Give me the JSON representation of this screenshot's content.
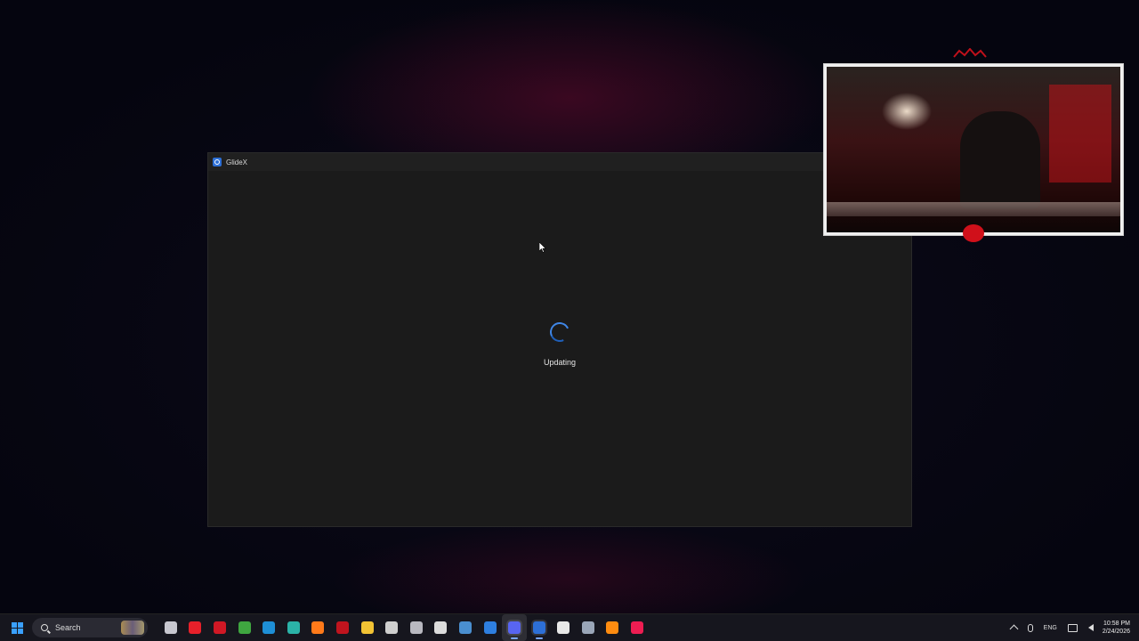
{
  "window": {
    "title": "GlideX",
    "icon": "glidex-app-icon",
    "status_text": "Updating",
    "spinner_color": "#3f86e6"
  },
  "overlay": {
    "name": "webcam-overlay"
  },
  "taskbar": {
    "search_label": "Search",
    "apps": [
      {
        "name": "task-view-icon",
        "color": "#c8c8d0",
        "active": false
      },
      {
        "name": "flash-app-icon",
        "color": "#e8202a",
        "active": false
      },
      {
        "name": "red-app-icon",
        "color": "#d01825",
        "active": false
      },
      {
        "name": "green-grid-app-icon",
        "color": "#3fa640",
        "active": false
      },
      {
        "name": "edge-browser-icon",
        "color": "#1e8fd6",
        "active": false
      },
      {
        "name": "teal-c-app-icon",
        "color": "#2bb3a8",
        "active": false
      },
      {
        "name": "firefox-icon",
        "color": "#ff7a1a",
        "active": false
      },
      {
        "name": "opera-icon",
        "color": "#c0141e",
        "active": false
      },
      {
        "name": "file-explorer-icon",
        "color": "#f2c334",
        "active": false
      },
      {
        "name": "unity-icon",
        "color": "#cfcfcf",
        "active": false
      },
      {
        "name": "github-desktop-icon",
        "color": "#b8b8c0",
        "active": false
      },
      {
        "name": "epic-games-icon",
        "color": "#dcdcdc",
        "active": false
      },
      {
        "name": "steam-icon",
        "color": "#4a8fd0",
        "active": false
      },
      {
        "name": "blue-app-icon",
        "color": "#2e7fe0",
        "active": false
      },
      {
        "name": "discord-icon",
        "color": "#5865f2",
        "active": true,
        "highlight": true
      },
      {
        "name": "glidex-taskbar-icon",
        "color": "#2d6fd6",
        "active": true,
        "highlight": false
      },
      {
        "name": "capcut-icon",
        "color": "#e8e8e8",
        "active": false
      },
      {
        "name": "settings-icon",
        "color": "#9aa6b8",
        "active": false
      },
      {
        "name": "vlc-icon",
        "color": "#ff8c10",
        "active": false
      },
      {
        "name": "tiktok-icon",
        "color": "#ee1d52",
        "active": false
      }
    ],
    "tray": {
      "language": "ENG",
      "time": "10:58 PM",
      "date": "2/24/2026"
    }
  }
}
